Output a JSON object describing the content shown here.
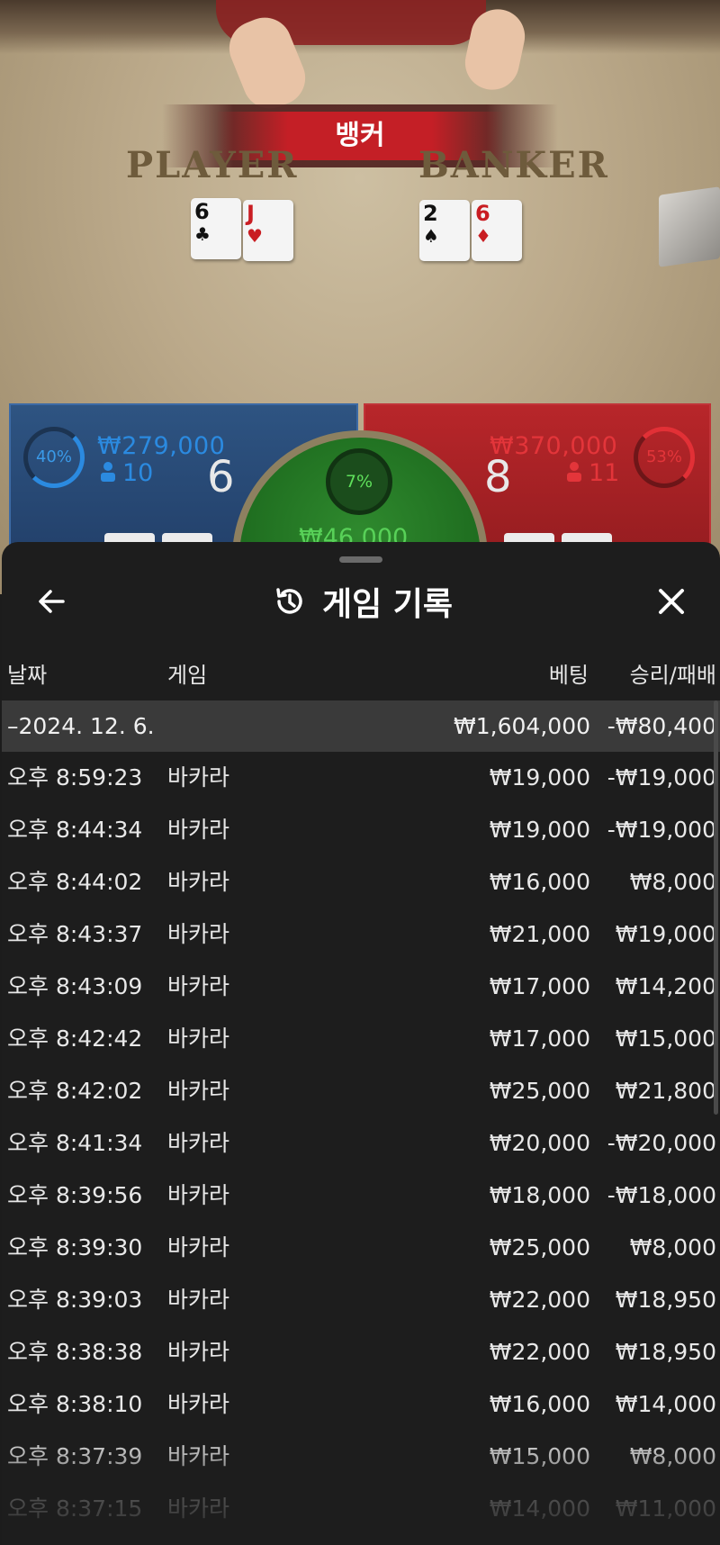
{
  "scene": {
    "winner_banner": "뱅커",
    "player_label": "PLAYER",
    "banker_label": "BANKER",
    "player_cards": [
      {
        "rank": "6",
        "suit": "♣",
        "color": "black"
      },
      {
        "rank": "J",
        "suit": "♥",
        "color": "red"
      }
    ],
    "banker_cards": [
      {
        "rank": "2",
        "suit": "♠",
        "color": "black"
      },
      {
        "rank": "6",
        "suit": "♦",
        "color": "red"
      }
    ]
  },
  "stats": {
    "player": {
      "percent": "40%",
      "amount": "₩279,000",
      "count": "10",
      "score": "6"
    },
    "banker": {
      "percent": "53%",
      "amount": "₩370,000",
      "count": "11",
      "score": "8"
    },
    "tie": {
      "percent": "7%",
      "amount": "₩46,000"
    }
  },
  "sheet": {
    "title": "게임 기록",
    "columns": {
      "date": "날짜",
      "game": "게임",
      "bet": "베팅",
      "result": "승리/패배"
    },
    "date_group": {
      "label": "–2024. 12. 6.",
      "bet": "₩1,604,000",
      "result": "-₩80,400"
    },
    "rows": [
      {
        "time": "오후 8:59:23",
        "game": "바카라",
        "bet": "₩19,000",
        "result": "-₩19,000"
      },
      {
        "time": "오후 8:44:34",
        "game": "바카라",
        "bet": "₩19,000",
        "result": "-₩19,000"
      },
      {
        "time": "오후 8:44:02",
        "game": "바카라",
        "bet": "₩16,000",
        "result": "₩8,000"
      },
      {
        "time": "오후 8:43:37",
        "game": "바카라",
        "bet": "₩21,000",
        "result": "₩19,000"
      },
      {
        "time": "오후 8:43:09",
        "game": "바카라",
        "bet": "₩17,000",
        "result": "₩14,200"
      },
      {
        "time": "오후 8:42:42",
        "game": "바카라",
        "bet": "₩17,000",
        "result": "₩15,000"
      },
      {
        "time": "오후 8:42:02",
        "game": "바카라",
        "bet": "₩25,000",
        "result": "₩21,800"
      },
      {
        "time": "오후 8:41:34",
        "game": "바카라",
        "bet": "₩20,000",
        "result": "-₩20,000"
      },
      {
        "time": "오후 8:39:56",
        "game": "바카라",
        "bet": "₩18,000",
        "result": "-₩18,000"
      },
      {
        "time": "오후 8:39:30",
        "game": "바카라",
        "bet": "₩25,000",
        "result": "₩8,000"
      },
      {
        "time": "오후 8:39:03",
        "game": "바카라",
        "bet": "₩22,000",
        "result": "₩18,950"
      },
      {
        "time": "오후 8:38:38",
        "game": "바카라",
        "bet": "₩22,000",
        "result": "₩18,950"
      },
      {
        "time": "오후 8:38:10",
        "game": "바카라",
        "bet": "₩16,000",
        "result": "₩14,000"
      },
      {
        "time": "오후 8:37:39",
        "game": "바카라",
        "bet": "₩15,000",
        "result": "₩8,000"
      },
      {
        "time": "오후 8:37:15",
        "game": "바카라",
        "bet": "₩14,000",
        "result": "₩11,000"
      }
    ]
  },
  "icons": {
    "back": "arrow-left-icon",
    "close": "close-icon",
    "history": "history-icon",
    "user": "user-icon"
  },
  "colors": {
    "player_blue": "#2b8ae0",
    "banker_red": "#e23036",
    "tie_green": "#5fe05b",
    "sheet_bg": "#1d1d1d"
  }
}
